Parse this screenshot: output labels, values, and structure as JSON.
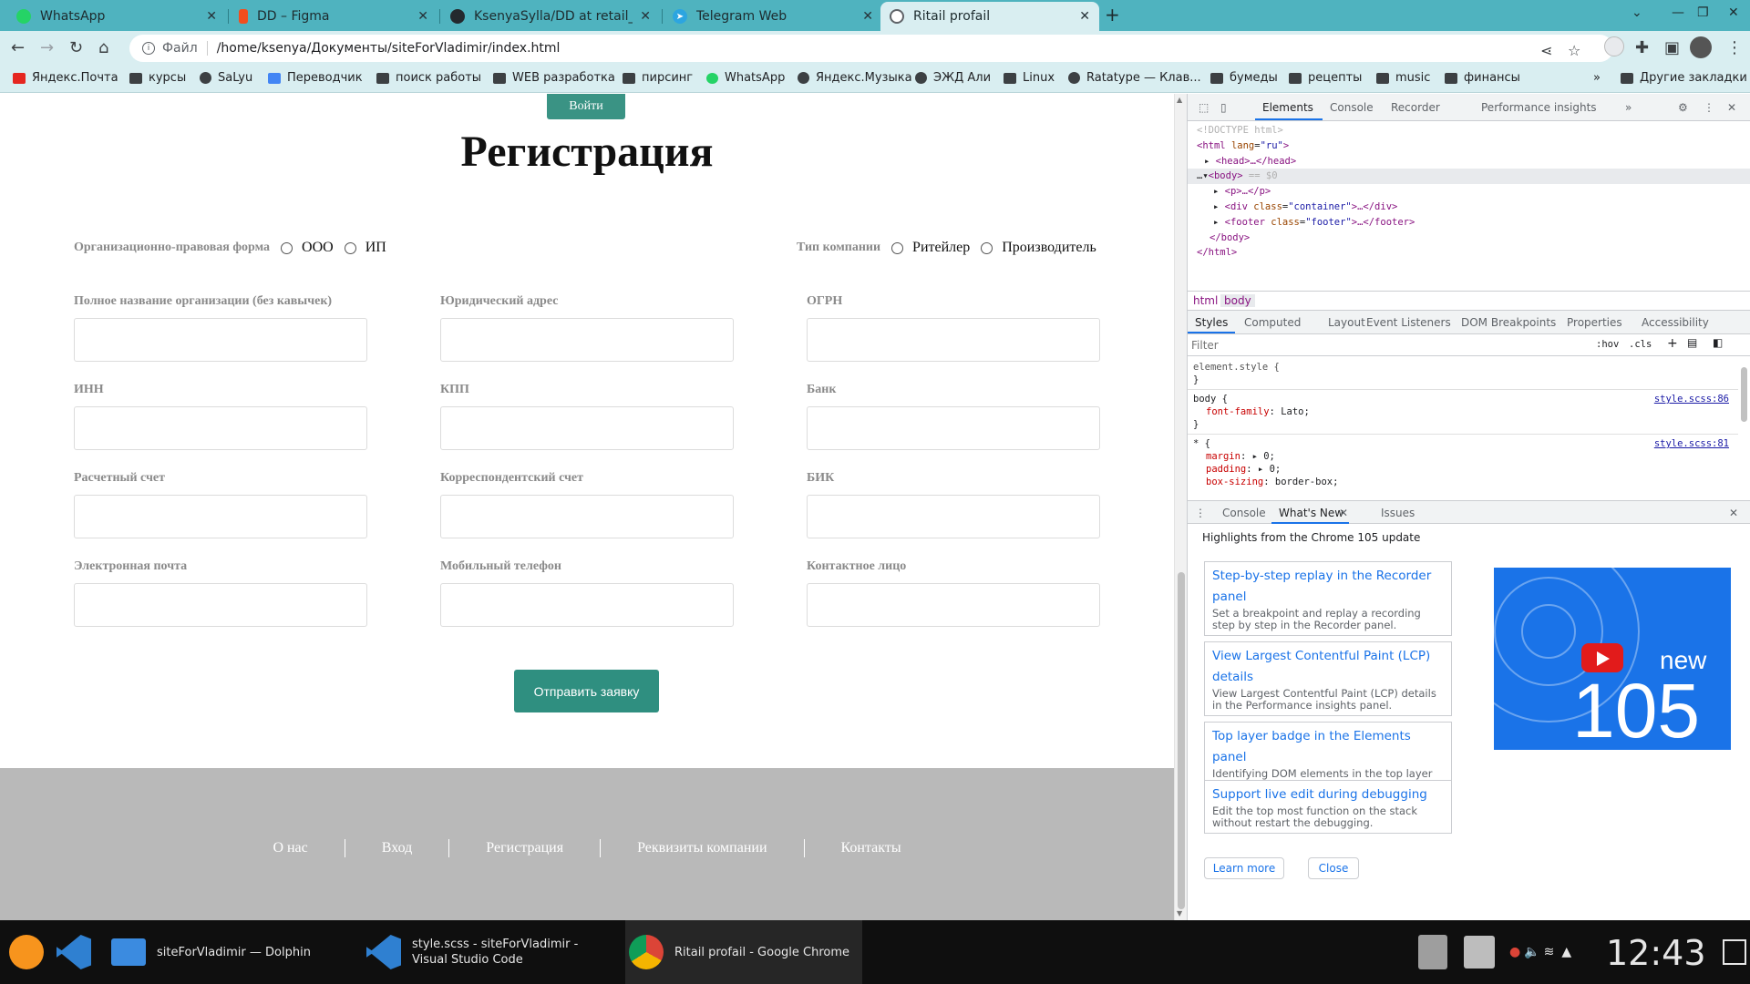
{
  "browser": {
    "tabs": [
      {
        "title": "WhatsApp",
        "color": "#25d366"
      },
      {
        "title": "DD – Figma",
        "color": "#f24e1e"
      },
      {
        "title": "KsenyaSylla/DD at retail_prof",
        "color": "#24292e"
      },
      {
        "title": "Telegram Web",
        "color": "#2ca5e0"
      },
      {
        "title": "Ritail profail",
        "color": "#5f6368"
      }
    ],
    "new_tab": "+",
    "address": {
      "scheme": "Файл",
      "url": "/home/ksenya/Документы/siteForVladimir/index.html"
    },
    "bookmarks": [
      "Яндекс.Почта",
      "курсы",
      "SaLyu",
      "Переводчик",
      "поиск работы",
      "WEB разработка",
      "пирсинг",
      "WhatsApp",
      "Яндекс.Музыка",
      "ЭЖД Али",
      "Linux",
      "Ratatype — Клав...",
      "бумеды",
      "рецепты",
      "music",
      "финансы"
    ],
    "other_bookmarks": "Другие закладки",
    "overflow": "»"
  },
  "page": {
    "login_button": "Войти",
    "title": "Регистрация",
    "org_form": {
      "label": "Организационно-правовая форма",
      "options": [
        "ООО",
        "ИП"
      ]
    },
    "company_type": {
      "label": "Тип компании",
      "options": [
        "Ритейлер",
        "Производитель"
      ]
    },
    "fields": [
      "Полное название организации (без кавычек)",
      "Юридический адрес",
      "ОГРН",
      "ИНН",
      "КПП",
      "Банк",
      "Расчетный счет",
      "Корреспондентский счет",
      "БИК",
      "Электронная почта",
      "Мобильный телефон",
      "Контактное лицо"
    ],
    "submit": "Отправить заявку",
    "footer": [
      "О нас",
      "Вход",
      "Регистрация",
      "Реквизиты компании",
      "Контакты"
    ]
  },
  "devtools": {
    "tabs": [
      "Elements",
      "Console",
      "Recorder",
      "Performance insights"
    ],
    "more": "»",
    "dom": {
      "doctype": "<!DOCTYPE html>",
      "html_open": "html",
      "lang_attr": "lang",
      "lang_val": "\"ru\"",
      "head": "<head>…</head>",
      "body": "<body>",
      "body_eq": " == $0",
      "p": "<p>…</p>",
      "div_tag": "div",
      "div_attr": "class",
      "div_val": "\"container\"",
      "div_rest": ">…</div>",
      "footer_tag": "footer",
      "footer_attr": "class",
      "footer_val": "\"footer\"",
      "footer_rest": ">…</footer>",
      "body_close": "</body>",
      "html_close": "</html>"
    },
    "breadcrumbs": [
      "html",
      "body"
    ],
    "style_tabs": [
      "Styles",
      "Computed",
      "Layout",
      "Event Listeners",
      "DOM Breakpoints",
      "Properties",
      "Accessibility"
    ],
    "filter_placeholder": "Filter",
    "hov": ":hov",
    "cls": ".cls",
    "styles": {
      "element_style": "element.style {",
      "close": "}",
      "body_sel": "body {",
      "body_src": "style.scss:86",
      "ff_prop": "font-family",
      "ff_val": "Lato;",
      "star_sel": "* {",
      "star_src": "style.scss:81",
      "margin_prop": "margin",
      "margin_val": "0;",
      "padding_prop": "padding",
      "padding_val": "0;",
      "bs_prop": "box-sizing",
      "bs_val": "border-box;"
    },
    "drawer_tabs": [
      "Console",
      "What's New",
      "Issues"
    ],
    "whats_new_header": "Highlights from the Chrome 105 update",
    "cards": [
      {
        "title": "Step-by-step replay in the Recorder panel",
        "desc": "Set a breakpoint and replay a recording step by step in the Recorder panel."
      },
      {
        "title": "View Largest Contentful Paint (LCP) details",
        "desc": "View Largest Contentful Paint (LCP) details in the Performance insights panel."
      },
      {
        "title": "Top layer badge in the Elements panel",
        "desc": "Identifying DOM elements in the top layer with the new badge."
      },
      {
        "title": "Support live edit during debugging",
        "desc": "Edit the top most function on the stack without restart the debugging."
      }
    ],
    "video": {
      "new": "new",
      "version": "105"
    },
    "learn_more": "Learn more",
    "close": "Close"
  },
  "taskbar": {
    "apps": [
      {
        "label": "siteForVladimir — Dolphin"
      },
      {
        "label": "style.scss - siteForVladimir - Visual Studio Code"
      },
      {
        "label": "Ritail profail - Google Chrome"
      }
    ],
    "clock": "12:43"
  }
}
